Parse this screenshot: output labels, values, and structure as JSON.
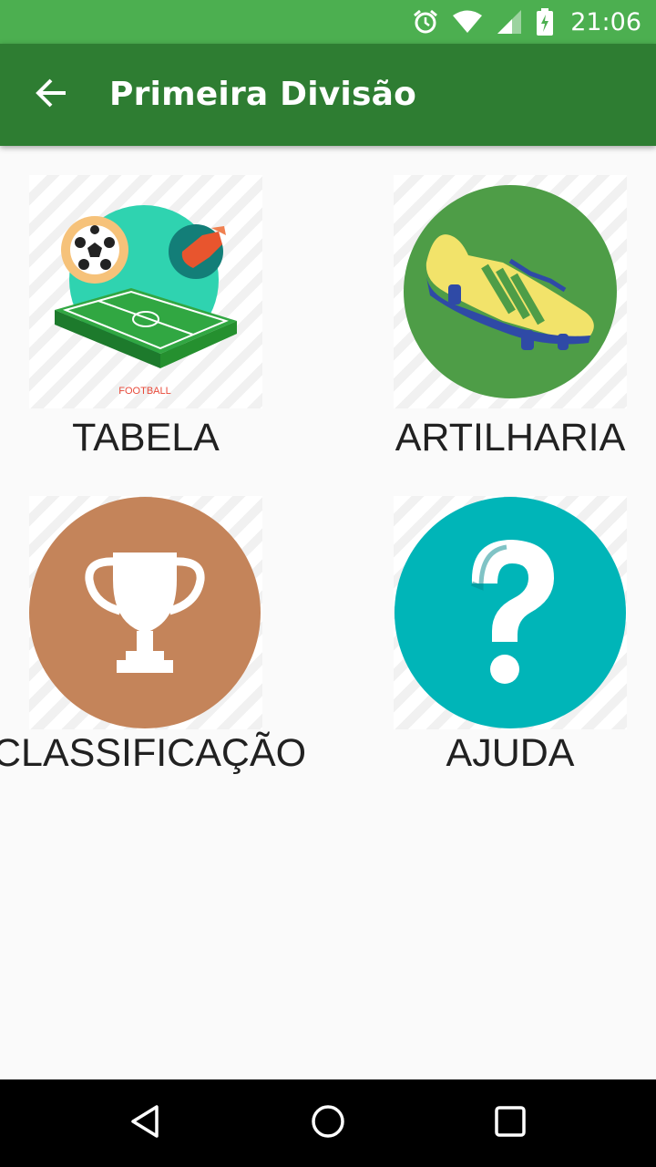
{
  "status_bar": {
    "time": "21:06",
    "icons": [
      "alarm-icon",
      "wifi-icon",
      "signal-icon",
      "battery-charging-icon"
    ],
    "color": "#4caf50"
  },
  "app_bar": {
    "title": "Primeira Divisão",
    "back_icon": "arrow-back-icon",
    "color": "#2e7d32"
  },
  "menu": {
    "items": [
      {
        "label": "TABELA",
        "icon": "football-field-icon"
      },
      {
        "label": "ARTILHARIA",
        "icon": "football-boot-icon",
        "color": "#4e9d47"
      },
      {
        "label": "CLASSIFICAÇÃO",
        "icon": "trophy-icon",
        "color": "#c4845a"
      },
      {
        "label": "AJUDA",
        "icon": "help-icon",
        "color": "#00b5b8"
      }
    ],
    "football_caption": "FOOTBALL"
  },
  "nav_bar": {
    "buttons": [
      "back-triangle-icon",
      "home-circle-icon",
      "recents-square-icon"
    ]
  }
}
